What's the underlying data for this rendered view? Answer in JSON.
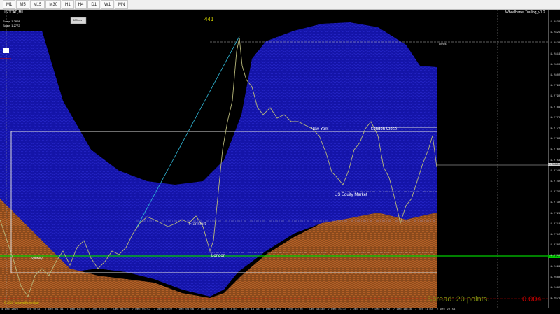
{
  "toolbar": {
    "timeframes": [
      "M1",
      "M5",
      "M15",
      "M30",
      "H1",
      "H4",
      "D1",
      "W1",
      "MN"
    ]
  },
  "chart": {
    "symbol_title": "USDCAD,M1",
    "sdays1": "Sdays 1.2808",
    "sdays2": "Sdays 1.2772",
    "small_button": "888 ms",
    "bar_counter": "441",
    "indicator_title": "Wheelbarrel Trailing_v1.2",
    "copyright": "© 2020 TopLevelEx.VirtSale",
    "spread_text": "Spread: 20 points.",
    "big_value": "0.004",
    "level_label": "Limits",
    "sessions": [
      "Frankfurt",
      "London",
      "New York",
      "London Close",
      "US Equity Market",
      "Sydney"
    ]
  },
  "price_scale": [
    "1.28325",
    "1.28265",
    "1.28205",
    "1.28145",
    "1.28085",
    "1.28025",
    "1.27965",
    "1.27905",
    "1.27845",
    "1.27785",
    "1.27725",
    "1.27665",
    "1.27605",
    "1.27545",
    "1.27485",
    "1.27425",
    "1.27365",
    "1.27305",
    "1.27245",
    "1.27185",
    "1.27125",
    "1.27065",
    "1.27005",
    "1.26945",
    "1.26885",
    "1.26825",
    "1.26765"
  ],
  "price_markers": {
    "current": "1.28020",
    "green": "1.27811"
  },
  "time_scale": [
    "4 Dec 2020",
    "7 Dec 00:37",
    "7 Dec 01:41",
    "7 Dec 02:45",
    "7 Dec 03:49",
    "7 Dec 04:53",
    "7 Dec 05:57",
    "7 Dec 07:02",
    "7 Dec 08:06",
    "7 Dec 09:10",
    "7 Dec 10:14",
    "7 Dec 11:18",
    "7 Dec 12:22",
    "7 Dec 13:26",
    "7 Dec 14:30",
    "7 Dec 15:34",
    "7 Dec 16:38",
    "7 Dec 17:42",
    "7 Dec 18:46",
    "7 Dec 19:50",
    "7 Dec 20:54"
  ],
  "colors": {
    "background": "#000000",
    "upper_band": "#1414a8",
    "lower_band": "#8a4a1c",
    "price": "#b8b87a",
    "trend_line": "#30b8d8",
    "green_line": "#00cc00",
    "red_line": "#cc0000",
    "spread_text": "#7a8a10",
    "counter_text": "#d0d000"
  }
}
